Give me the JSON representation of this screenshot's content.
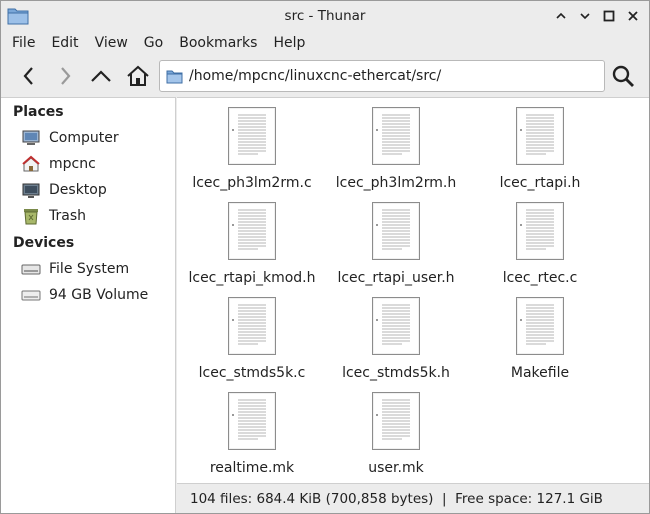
{
  "window": {
    "title": "src - Thunar",
    "buttons": [
      "chevron-up-icon",
      "chevron-down-icon",
      "maximize-icon",
      "close-icon"
    ]
  },
  "menubar": {
    "items": [
      {
        "label": "File"
      },
      {
        "label": "Edit"
      },
      {
        "label": "View"
      },
      {
        "label": "Go"
      },
      {
        "label": "Bookmarks"
      },
      {
        "label": "Help"
      }
    ]
  },
  "toolbar": {
    "back_icon": "back-arrow-icon",
    "forward_icon": "forward-arrow-icon",
    "up_icon": "up-arrow-icon",
    "home_icon": "home-icon",
    "search_icon": "search-icon",
    "location": "/home/mpcnc/linuxcnc-ethercat/src/"
  },
  "sidebar": {
    "places_title": "Places",
    "places": [
      {
        "label": "Computer",
        "icon": "computer-icon"
      },
      {
        "label": "mpcnc",
        "icon": "home-folder-icon"
      },
      {
        "label": "Desktop",
        "icon": "desktop-icon"
      },
      {
        "label": "Trash",
        "icon": "trash-icon"
      }
    ],
    "devices_title": "Devices",
    "devices": [
      {
        "label": "File System",
        "icon": "drive-icon"
      },
      {
        "label": "94 GB Volume",
        "icon": "drive-icon"
      }
    ]
  },
  "files": [
    {
      "name": "lcec_ph3lm2rm.c"
    },
    {
      "name": "lcec_ph3lm2rm.h"
    },
    {
      "name": "lcec_rtapi.h"
    },
    {
      "name": "lcec_rtapi_kmod.h"
    },
    {
      "name": "lcec_rtapi_user.h"
    },
    {
      "name": "lcec_rtec.c"
    },
    {
      "name": "lcec_stmds5k.c"
    },
    {
      "name": "lcec_stmds5k.h"
    },
    {
      "name": "Makefile"
    },
    {
      "name": "realtime.mk"
    },
    {
      "name": "user.mk"
    }
  ],
  "statusbar": {
    "text": "104 files: 684.4 KiB (700,858 bytes)  |  Free space: 127.1 GiB"
  },
  "colors": {
    "accent_blue": "#3a7bc8",
    "chrome": "#ececec",
    "white": "#ffffff"
  }
}
